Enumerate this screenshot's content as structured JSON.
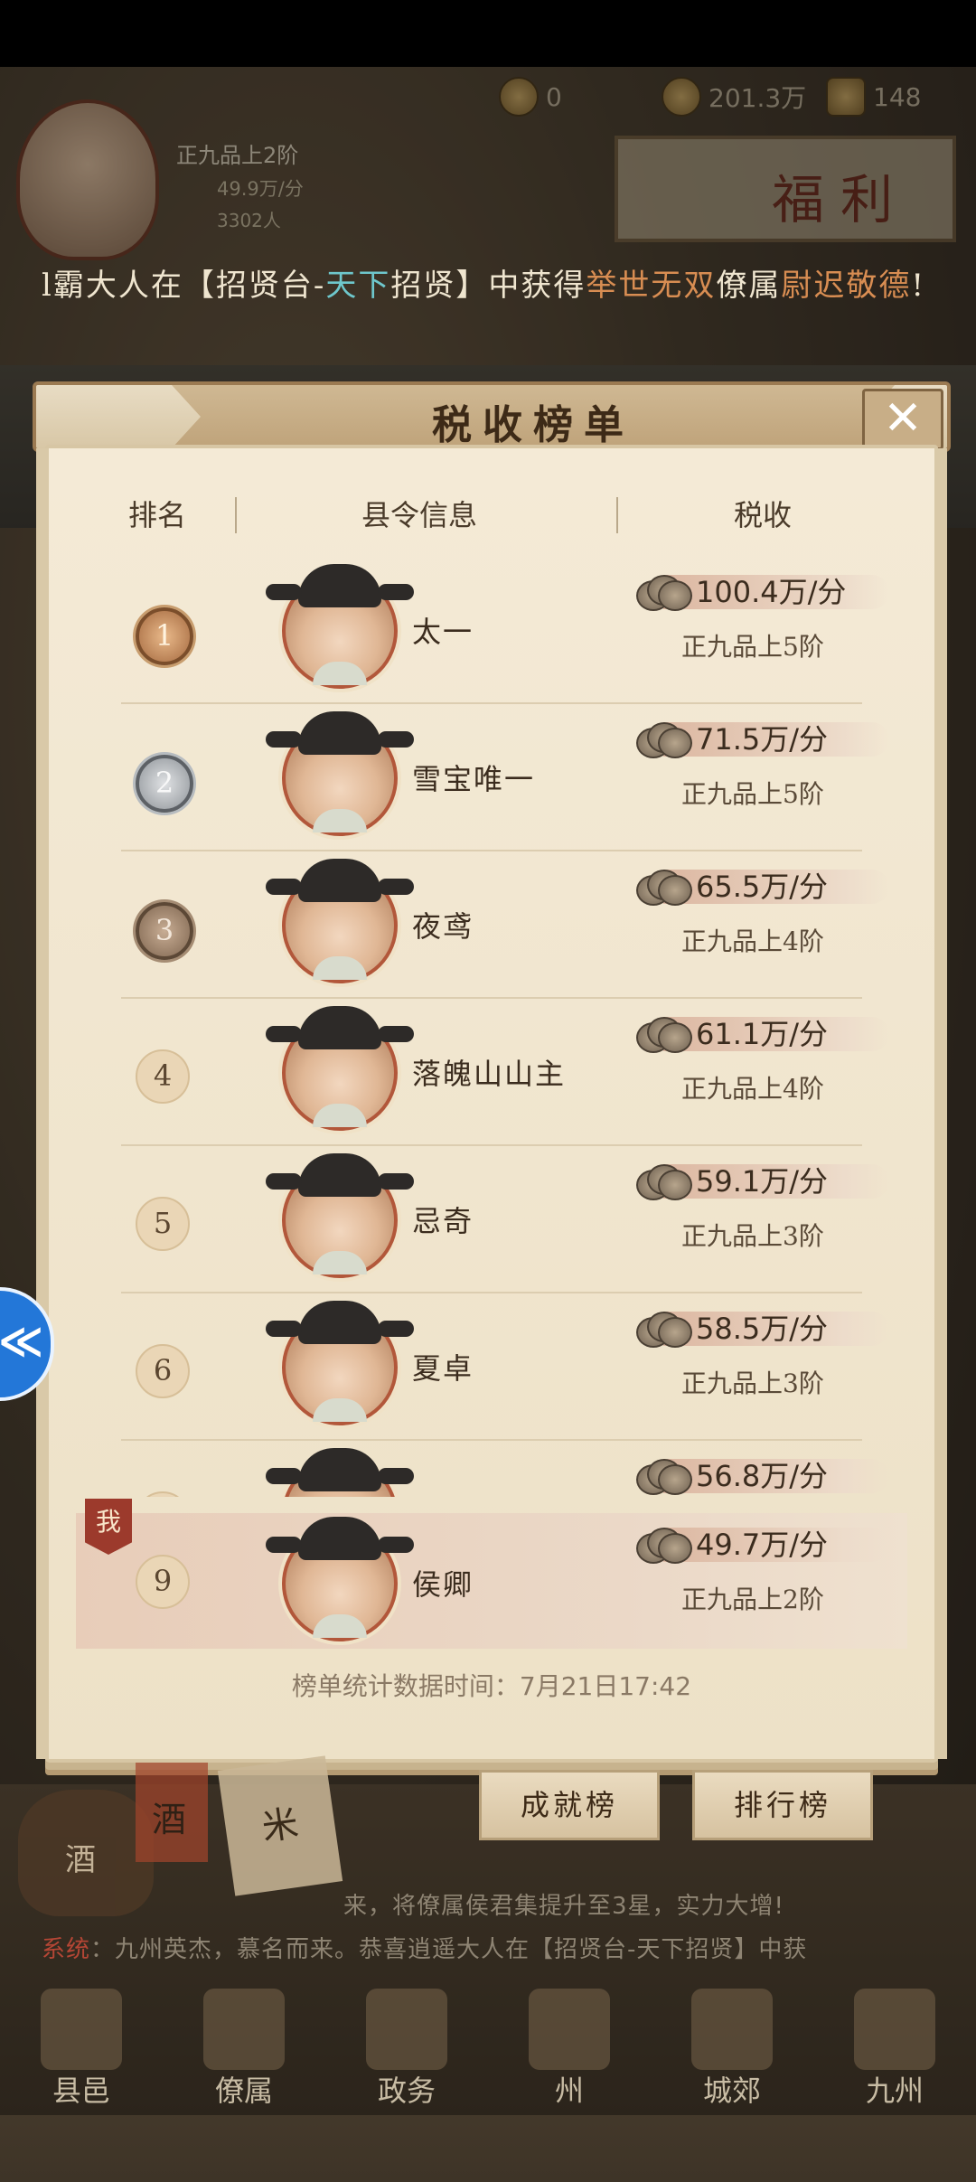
{
  "hud": {
    "res1": "0",
    "res2": "201.3万",
    "res3": "148",
    "player_rank": "正九品上2阶",
    "player_income": "49.9万/分",
    "player_count": "3302人",
    "fuli": "福利"
  },
  "marquee": {
    "part1": "l霸大人在【招贤台-",
    "part2": "天下",
    "part3": "招贤】中获得",
    "part4": "举世无双",
    "part5": "僚属",
    "part6": "尉迟敬德",
    "part7": "!"
  },
  "modal": {
    "title": "税收榜单",
    "close": "✕",
    "columns": {
      "rank": "排名",
      "info": "县令信息",
      "tax": "税收"
    },
    "rows": [
      {
        "rank": "1",
        "name": "太一",
        "tax": "100.4万/分",
        "grade": "正九品上5阶"
      },
      {
        "rank": "2",
        "name": "雪宝唯一",
        "tax": "71.5万/分",
        "grade": "正九品上5阶"
      },
      {
        "rank": "3",
        "name": "夜鸢",
        "tax": "65.5万/分",
        "grade": "正九品上4阶"
      },
      {
        "rank": "4",
        "name": "落魄山山主",
        "tax": "61.1万/分",
        "grade": "正九品上4阶"
      },
      {
        "rank": "5",
        "name": "忌奇",
        "tax": "59.1万/分",
        "grade": "正九品上3阶"
      },
      {
        "rank": "6",
        "name": "夏卓",
        "tax": "58.5万/分",
        "grade": "正九品上3阶"
      },
      {
        "rank": "",
        "name": "",
        "tax": "56.8万/分",
        "grade": ""
      }
    ],
    "me": {
      "flag": "我",
      "rank": "9",
      "name": "侯卿",
      "tax": "49.7万/分",
      "grade": "正九品上2阶"
    },
    "footnote": "榜单统计数据时间：7月21日17:42"
  },
  "buttons": {
    "achievement": "成就榜",
    "ranking": "排行榜"
  },
  "decor": {
    "jar": "酒",
    "sack": "米",
    "banner": "酒"
  },
  "chat": {
    "line1": "来，将僚属侯君集提升至3星，实力大增!",
    "line2_sys": "系统",
    "line2": "：九州英杰，慕名而来。恭喜逍遥大人在【招贤台-天下招贤】中获"
  },
  "nav": [
    "县邑",
    "僚属",
    "政务",
    "州",
    "城郊",
    "九州"
  ]
}
